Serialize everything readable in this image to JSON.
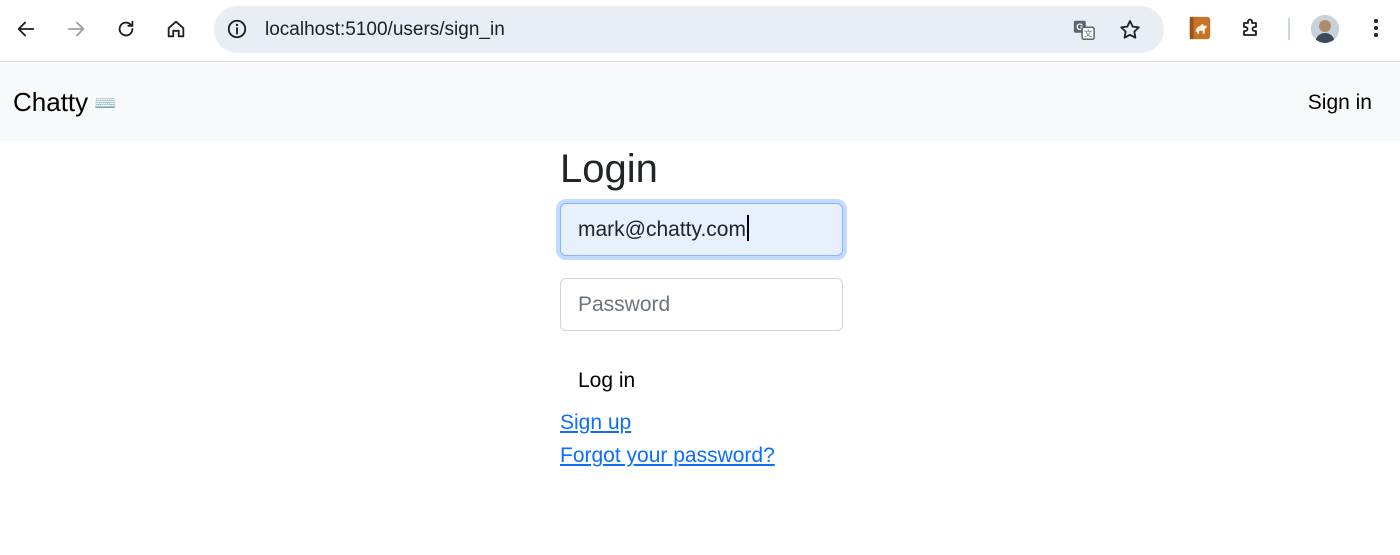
{
  "browser": {
    "url": "localhost:5100/users/sign_in",
    "back_icon": "arrow-left-icon",
    "forward_icon": "arrow-right-icon",
    "reload_icon": "reload-icon",
    "home_icon": "home-icon",
    "info_icon": "info-icon",
    "translate_icon": "translate-icon",
    "bookmark_icon": "star-icon",
    "extension_icon": "puzzle-icon",
    "menu_icon": "kebab-menu-icon"
  },
  "navbar": {
    "brand": "Chatty",
    "brand_emoji": "⌨️",
    "signin": "Sign in"
  },
  "login": {
    "title": "Login",
    "email_value": "mark@chatty.com",
    "password_placeholder": "Password",
    "submit_label": "Log in",
    "signup_link": "Sign up",
    "forgot_link": "Forgot your password?"
  },
  "colors": {
    "link": "#0d6efd",
    "navbar_bg": "#f8f9fa",
    "omnibox_bg": "#e9eef6",
    "autofill_bg": "#e8f0fe"
  }
}
